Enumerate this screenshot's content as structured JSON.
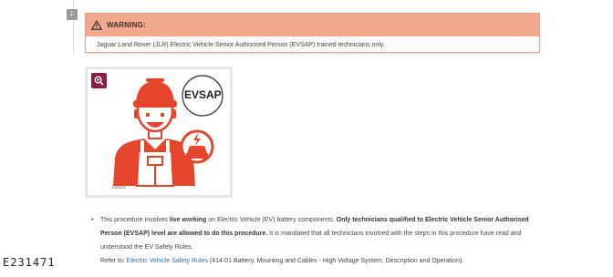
{
  "step": {
    "number": "1."
  },
  "warning": {
    "title": "WARNING:",
    "text": "Jaguar Land Rover (JLR) Electric Vehicle Senior Authorised Person (EVSAP) trained technicians only.",
    "icon": "warning-triangle-icon",
    "header_color": "#f2a88c"
  },
  "figure": {
    "badge": "EVSAP",
    "code": "E200432",
    "zoom_icon": "zoom-in-icon",
    "accent_color": "#e5452b"
  },
  "bullet": {
    "p1": "This procedure involves ",
    "b1": "live working",
    "p2": " on Electric Vehicle (EV) battery components. ",
    "b2": "Only technicians qualified to Electric Vehicle Senior Authorised Person (EVSAP) level are allowed to do this procedure.",
    "p3": " It is mandated that all technicians involved with the steps in this procedure have read and understood the EV Safety Rules.",
    "refer_prefix": "Refer to: ",
    "refer_link": "Electric Vehicle Safety Rules",
    "refer_suffix": " (414-01 Battery, Mounting and Cables - High Voltage System, Description and Operation)."
  },
  "image_id": "E231471"
}
